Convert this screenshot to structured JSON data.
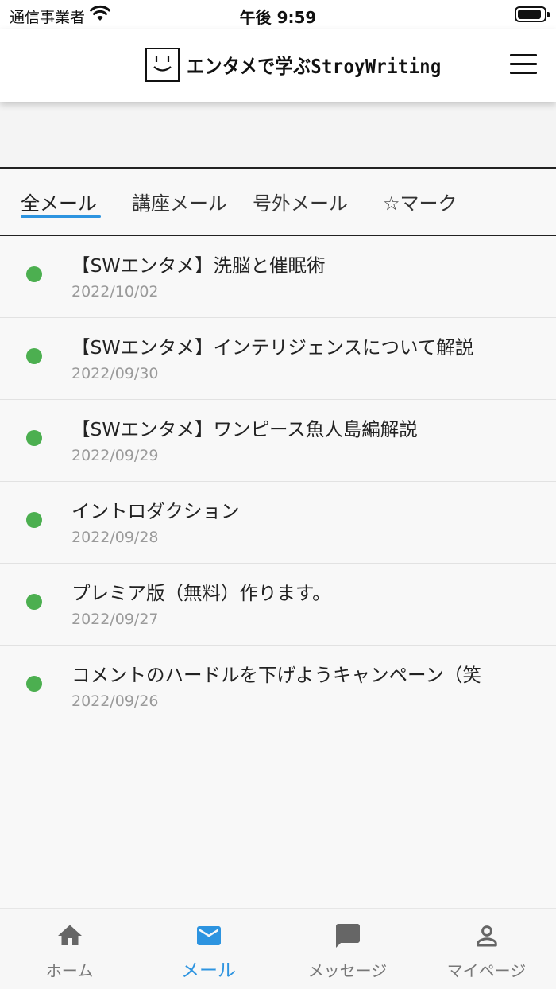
{
  "status_bar": {
    "carrier": "通信事業者",
    "time": "午後 9:59",
    "battery_level": 0.9
  },
  "header": {
    "logo_text": "エンタメで学ぶStroyWriting",
    "menu_icon": "hamburger-menu-icon"
  },
  "tabs": [
    {
      "label": "全メール",
      "active": true
    },
    {
      "label": "講座メール",
      "active": false
    },
    {
      "label": "号外メール",
      "active": false
    },
    {
      "label": "☆マーク",
      "active": false
    }
  ],
  "mails": [
    {
      "title": "【SWエンタメ】洗脳と催眠術",
      "date": "2022/10/02",
      "unread": true
    },
    {
      "title": "【SWエンタメ】インテリジェンスについて解説",
      "date": "2022/09/30",
      "unread": true
    },
    {
      "title": "【SWエンタメ】ワンピース魚人島編解説",
      "date": "2022/09/29",
      "unread": true
    },
    {
      "title": "イントロダクション",
      "date": "2022/09/28",
      "unread": true
    },
    {
      "title": "プレミア版（無料）作ります。",
      "date": "2022/09/27",
      "unread": true
    },
    {
      "title": "コメントのハードルを下げようキャンペーン（笑",
      "date": "2022/09/26",
      "unread": true
    }
  ],
  "bottom_nav": [
    {
      "label": "ホーム",
      "icon": "home-icon",
      "active": false
    },
    {
      "label": "メール",
      "icon": "mail-icon",
      "active": true
    },
    {
      "label": "メッセージ",
      "icon": "chat-icon",
      "active": false
    },
    {
      "label": "マイページ",
      "icon": "person-icon",
      "active": false
    }
  ],
  "colors": {
    "accent": "#2d94e0",
    "unread_dot": "#4caf50",
    "inactive_nav": "#777777"
  }
}
